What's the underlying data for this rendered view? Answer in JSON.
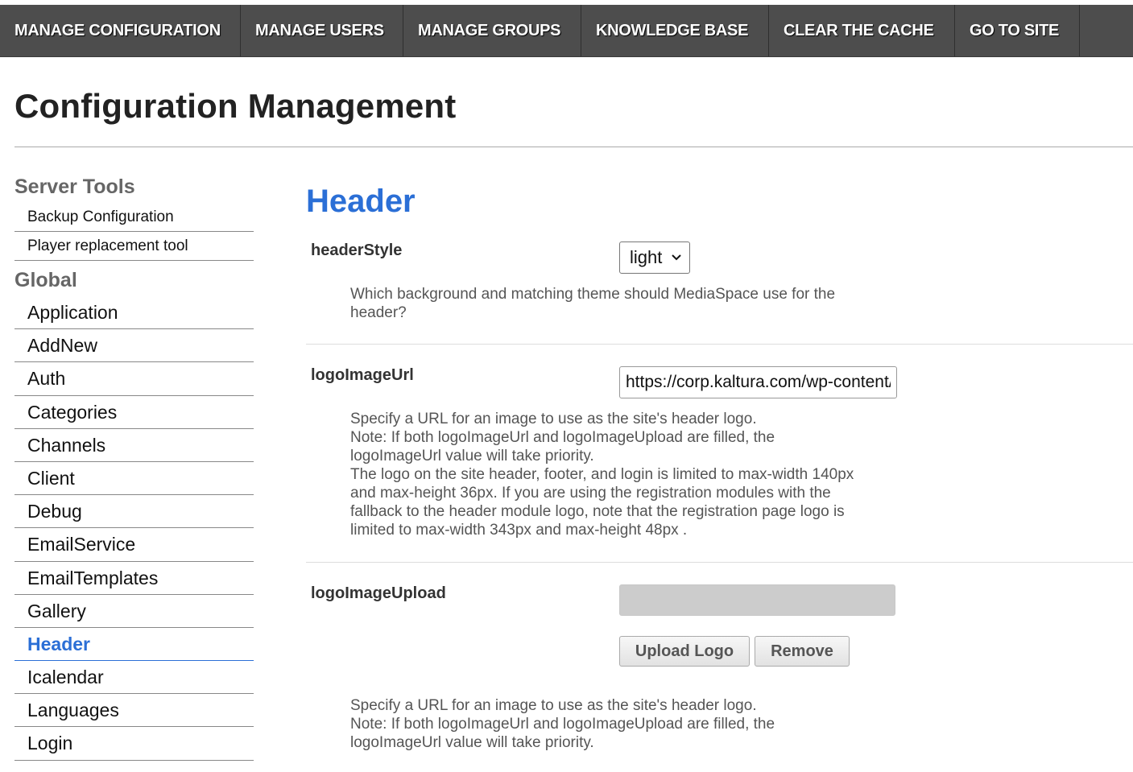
{
  "nav": {
    "items": [
      {
        "label": "MANAGE CONFIGURATION"
      },
      {
        "label": "MANAGE USERS"
      },
      {
        "label": "MANAGE GROUPS"
      },
      {
        "label": "KNOWLEDGE BASE"
      },
      {
        "label": "CLEAR THE CACHE"
      },
      {
        "label": "GO TO SITE"
      }
    ]
  },
  "page": {
    "title": "Configuration Management"
  },
  "sidebar": {
    "server_tools": {
      "heading": "Server Tools",
      "items": [
        {
          "label": "Backup Configuration"
        },
        {
          "label": "Player replacement tool"
        }
      ]
    },
    "global": {
      "heading": "Global",
      "items": [
        {
          "label": "Application"
        },
        {
          "label": "AddNew"
        },
        {
          "label": "Auth"
        },
        {
          "label": "Categories"
        },
        {
          "label": "Channels"
        },
        {
          "label": "Client"
        },
        {
          "label": "Debug"
        },
        {
          "label": "EmailService"
        },
        {
          "label": "EmailTemplates"
        },
        {
          "label": "Gallery"
        },
        {
          "label": "Header"
        },
        {
          "label": "Icalendar"
        },
        {
          "label": "Languages"
        },
        {
          "label": "Login"
        }
      ],
      "active": "Header"
    }
  },
  "main": {
    "heading": "Header",
    "fields": {
      "header_style": {
        "label": "headerStyle",
        "value": "light",
        "description": "Which background and matching theme should MediaSpace use for the header?"
      },
      "logo_image_url": {
        "label": "logoImageUrl",
        "value": "https://corp.kaltura.com/wp-content/",
        "desc_lines": [
          "Specify a URL for an image to use as the site's header logo.",
          "Note: If both logoImageUrl and logoImageUpload are filled, the logoImageUrl value will take priority.",
          "The logo on the site header, footer, and login is limited to max-width 140px and max-height 36px. If you are using the registration modules with the fallback to the header module logo, note that the registration page logo is limited to max-width 343px and max-height 48px ."
        ]
      },
      "logo_image_upload": {
        "label": "logoImageUpload",
        "upload_label": "Upload Logo",
        "remove_label": "Remove",
        "desc_lines": [
          "Specify a URL for an image to use as the site's header logo.",
          "Note: If both logoImageUrl and logoImageUpload are filled, the logoImageUrl value will take priority."
        ]
      }
    }
  },
  "colors": {
    "nav_bg": "#4d4d4d",
    "accent": "#2b6fd6"
  },
  "icons": {
    "select_chevron": "chevron-down-icon"
  }
}
